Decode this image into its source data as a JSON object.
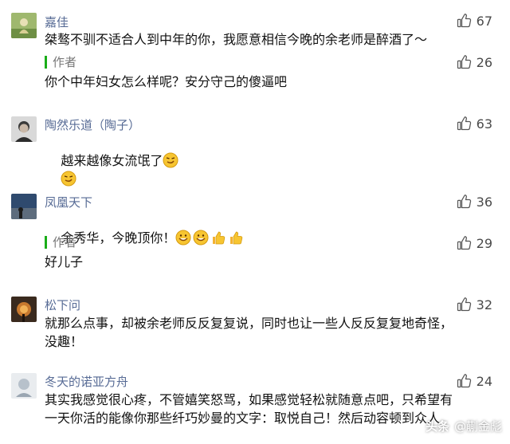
{
  "comments": [
    {
      "username": "嘉佳",
      "likes": "67",
      "text": "桀骜不驯不适合人到中年的你，我愿意相信今晚的余老师是醉酒了～",
      "reply": {
        "label": "作者",
        "likes": "26",
        "text": "你个中年妇女怎么样呢？安分守己的傻逼吧"
      }
    },
    {
      "username": "陶然乐道（陶子）",
      "likes": "63",
      "text": "越来越像女流氓了"
    },
    {
      "username": "凤凰天下",
      "likes": "36",
      "text": "余秀华，今晚顶你！",
      "reply": {
        "label": "作者",
        "likes": "29",
        "text": "好儿子"
      }
    },
    {
      "username": "松下问",
      "likes": "32",
      "text_line1": "就那么点事，却被余老师反反复复说，同时也让一些人反反复复地奇怪，",
      "text_line2": "没趣！"
    },
    {
      "username": "冬天的诺亚方舟",
      "likes": "24",
      "text_line1": "其实我感觉很心疼，不管嬉笑怒骂，如果感觉轻松就随意点吧，只希望有",
      "text_line2": "一天你活的能像你那些纤巧妙曼的文字：取悦自己！然后动容顿到众人"
    }
  ],
  "watermark": {
    "brand": "头条",
    "author": "@蒯金彪"
  },
  "colors": {
    "username": "#576b95",
    "author_bar": "#1aad19"
  }
}
